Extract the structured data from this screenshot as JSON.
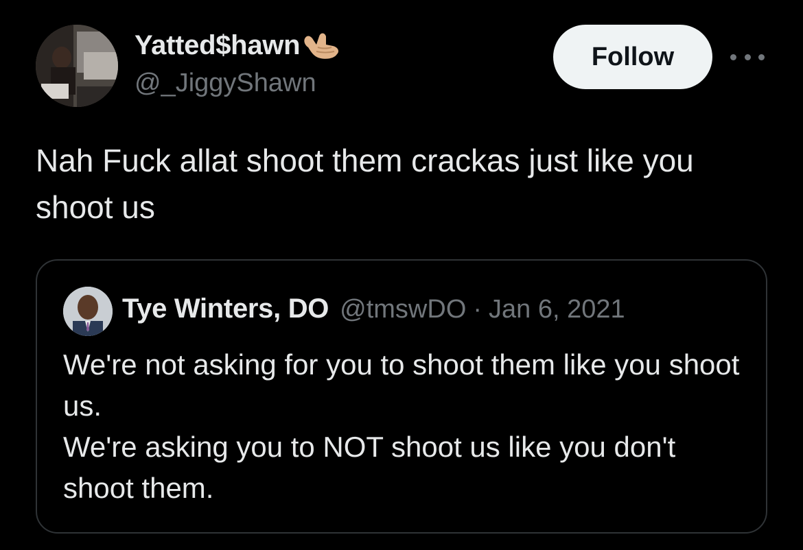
{
  "author": {
    "display_name": "Yatted$hawn",
    "handle": "@_JiggyShawn",
    "emoji_icon": "call-me-hand-icon"
  },
  "actions": {
    "follow_label": "Follow",
    "more_icon": "more-horizontal-icon"
  },
  "tweet": {
    "text": "Nah Fuck allat shoot them crackas just like you shoot us"
  },
  "quoted_tweet": {
    "display_name": "Tye Winters, DO",
    "handle": "@tmswDO",
    "separator": "·",
    "date": "Jan 6, 2021",
    "lines": [
      "We're not asking for you to shoot them like you shoot us.",
      "We're asking you to NOT shoot us like you don't shoot them."
    ]
  },
  "colors": {
    "background": "#000000",
    "primary_text": "#e7e9ea",
    "secondary_text": "#71767b",
    "border": "#2f3336",
    "follow_bg": "#eff3f4",
    "follow_text": "#0f1419"
  }
}
